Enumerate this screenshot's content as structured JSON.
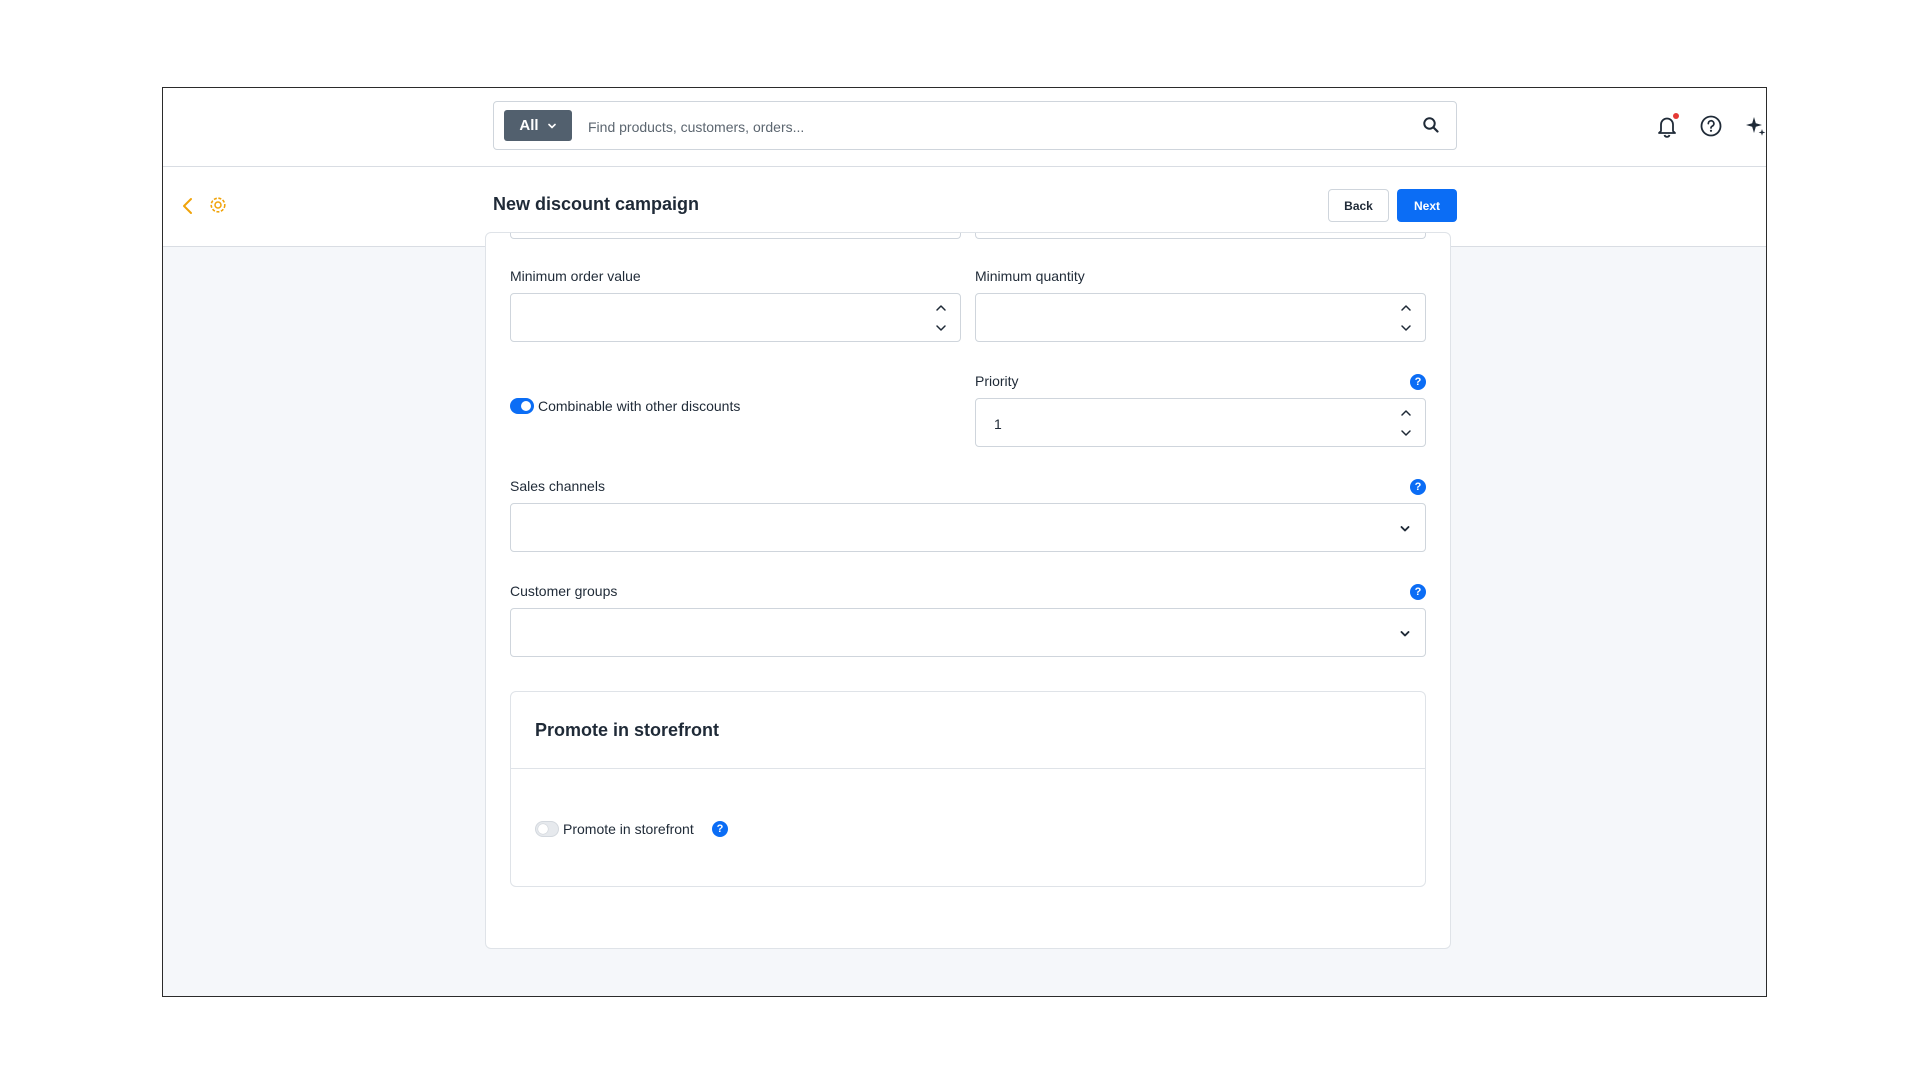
{
  "search": {
    "scope_label": "All",
    "placeholder": "Find products, customers, orders..."
  },
  "header_icons": {
    "notifications": "bell-icon",
    "help": "question-circle-icon",
    "assistant": "sparkles-icon",
    "notification_dot_color": "#e53935"
  },
  "page": {
    "title": "New discount campaign",
    "back_label": "Back",
    "next_label": "Next"
  },
  "form": {
    "min_order_value": {
      "label": "Minimum order value",
      "value": ""
    },
    "min_quantity": {
      "label": "Minimum quantity",
      "value": ""
    },
    "combinable": {
      "label": "Combinable with other discounts",
      "enabled": true
    },
    "priority": {
      "label": "Priority",
      "value": "1",
      "help": "?"
    },
    "sales_channels": {
      "label": "Sales channels",
      "value": "",
      "help": "?"
    },
    "customer_groups": {
      "label": "Customer groups",
      "value": "",
      "help": "?"
    }
  },
  "storefront": {
    "section_title": "Promote in storefront",
    "toggle_label": "Promote in storefront",
    "enabled": false,
    "help": "?"
  },
  "colors": {
    "accent": "#0b6df5",
    "nav_icon": "#f0a30a",
    "scope_button": "#52606e"
  }
}
